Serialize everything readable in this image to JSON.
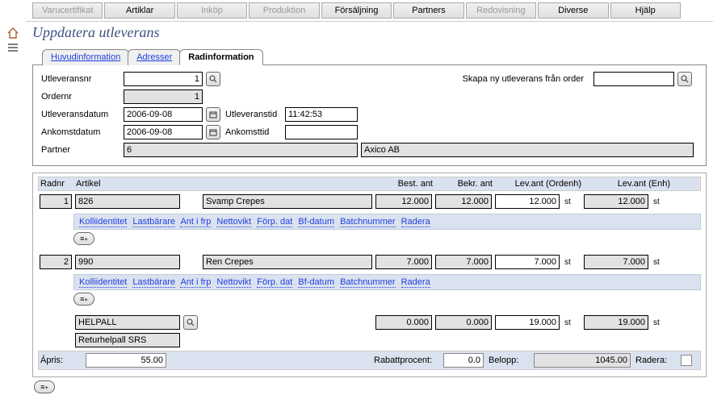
{
  "topTabs": [
    {
      "label": "Varucertifikat",
      "enabled": false
    },
    {
      "label": "Artiklar",
      "enabled": true
    },
    {
      "label": "Inköp",
      "enabled": false
    },
    {
      "label": "Produktion",
      "enabled": false
    },
    {
      "label": "Försäljning",
      "enabled": true
    },
    {
      "label": "Partners",
      "enabled": true
    },
    {
      "label": "Redovisning",
      "enabled": false
    },
    {
      "label": "Diverse",
      "enabled": true
    },
    {
      "label": "Hjälp",
      "enabled": true
    }
  ],
  "pageTitle": "Uppdatera utleverans",
  "innerTabs": {
    "huvud": "Huvudinformation",
    "adresser": "Adresser",
    "radinfo": "Radinformation"
  },
  "form": {
    "utleveransnr_lbl": "Utleveransnr",
    "utleveransnr": "1",
    "ordernr_lbl": "Ordernr",
    "ordernr": "1",
    "utlevdatum_lbl": "Utleveransdatum",
    "utlevdatum": "2006-09-08",
    "utlevtid_lbl": "Utleveranstid",
    "utlevtid": "11:42:53",
    "ankdatum_lbl": "Ankomstdatum",
    "ankdatum": "2006-09-08",
    "anktid_lbl": "Ankomsttid",
    "anktid": "",
    "partner_lbl": "Partner",
    "partner_id": "6",
    "partner_name": "Axico AB",
    "skapa_lbl": "Skapa ny utleverans från order",
    "skapa_val": ""
  },
  "cols": {
    "radnr": "Radnr",
    "artikel": "Artikel",
    "best": "Best. ant",
    "bekr": "Bekr. ant",
    "levord": "Lev.ant (Ordenh)",
    "levenh": "Lev.ant (Enh)"
  },
  "subLinks": [
    "Kolliidentitet",
    "Lastbärare",
    "Ant i frp",
    "Nettovikt",
    "Förp. dat",
    "Bf-datum",
    "Batchnummer",
    "Radera"
  ],
  "rows": [
    {
      "radnr": "1",
      "art": "826",
      "artname": "Svamp Crepes",
      "best": "12.000",
      "bekr": "12.000",
      "levord": "12.000",
      "levenh": "12.000",
      "unit": "st"
    },
    {
      "radnr": "2",
      "art": "990",
      "artname": "Ren Crepes",
      "best": "7.000",
      "bekr": "7.000",
      "levord": "7.000",
      "levenh": "7.000",
      "unit": "st"
    }
  ],
  "extraRow": {
    "art": "HELPALL",
    "artname": "Returhelpall SRS",
    "best": "0.000",
    "bekr": "0.000",
    "levord": "19.000",
    "levenh": "19.000",
    "unit": "st"
  },
  "footer": {
    "apris_lbl": "Ápris:",
    "apris": "55.00",
    "rabatt_lbl": "Rabattprocent:",
    "rabatt": "0.0",
    "belopp_lbl": "Belopp:",
    "belopp": "1045.00",
    "radera_lbl": "Radera:"
  },
  "unit_st": "st"
}
